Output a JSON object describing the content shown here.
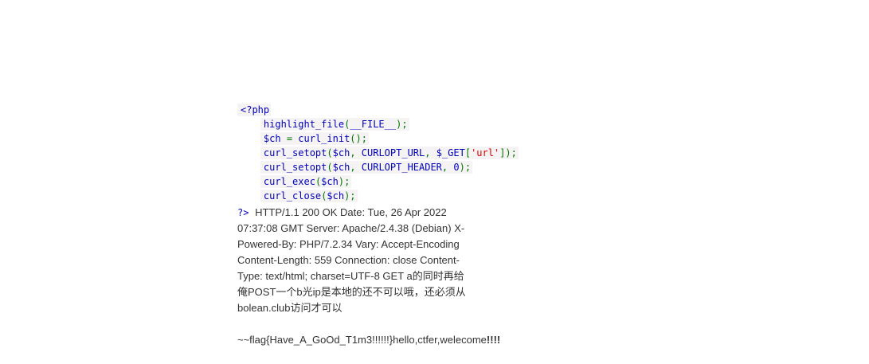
{
  "source_code": {
    "open_tag": "<?php",
    "lines": [
      "highlight_file(__FILE__);",
      "$ch = curl_init();",
      "curl_setopt($ch, CURLOPT_URL, $_GET['url']);",
      "curl_setopt($ch, CURLOPT_HEADER, 0);",
      "curl_exec($ch);",
      "curl_close($ch);"
    ],
    "close_tag": "?>"
  },
  "response": {
    "text": "HTTP/1.1 200 OK Date: Tue, 26 Apr 2022 07:37:08 GMT Server: Apache/2.4.38 (Debian) X-Powered-By: PHP/7.2.34 Vary: Accept-Encoding Content-Length: 559 Connection: close Content-Type: text/html; charset=UTF-8 GET a的同时再给俺POST一个b光ip是本地的还不可以哦，还必须从bolean.club访问才可以",
    "flag_prefix": "~~flag{Have_A_GoOd_T1m3",
    "flag_bangs": "!!!!!!",
    "flag_suffix": "}hello,ctfer,welecome",
    "flag_end": "!!!!"
  }
}
